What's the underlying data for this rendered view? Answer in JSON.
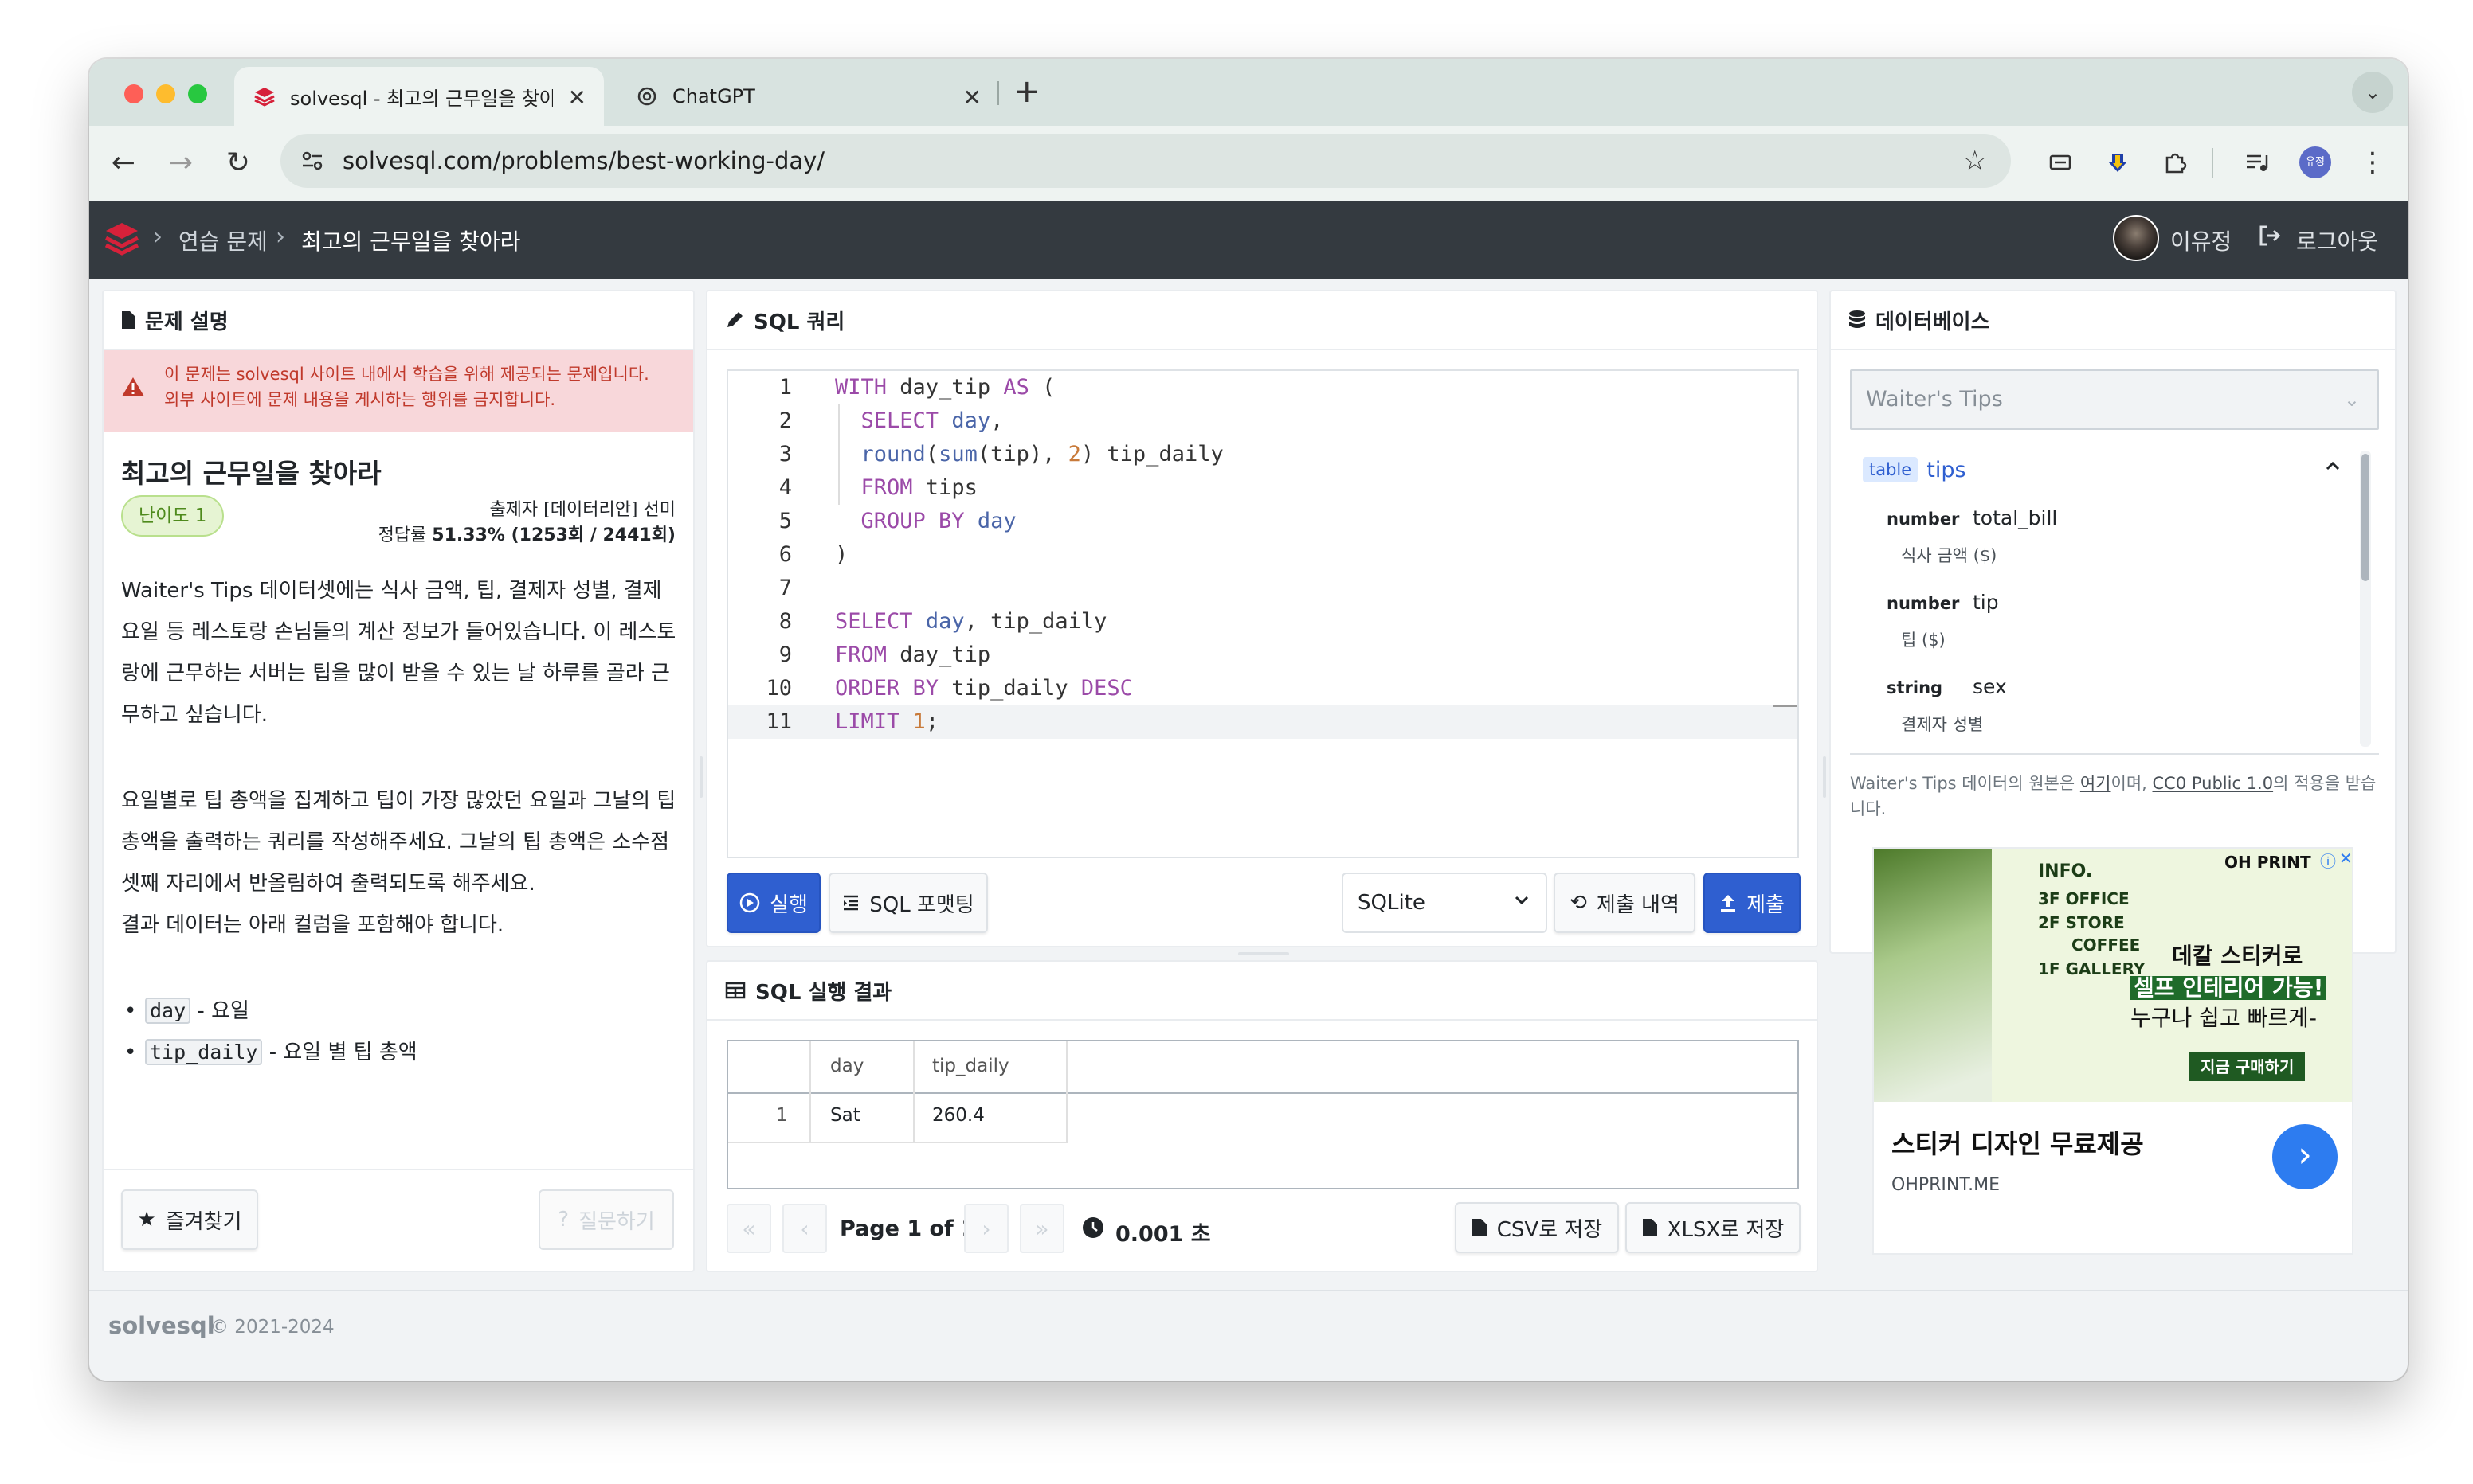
{
  "browser": {
    "tabs": [
      {
        "title": "solvesql - 최고의 근무일을 찾아라",
        "active": true
      },
      {
        "title": "ChatGPT",
        "active": false
      }
    ],
    "url": "solvesql.com/problems/best-working-day/"
  },
  "header": {
    "breadcrumbs": [
      "연습 문제",
      "최고의 근무일을 찾아라"
    ],
    "user_name": "이유정",
    "logout_label": "로그아웃",
    "profile_badge": "유정"
  },
  "problem": {
    "panel_title": "문제 설명",
    "alert_line1": "이 문제는 solvesql 사이트 내에서 학습을 위해 제공되는 문제입니다.",
    "alert_line2": "외부 사이트에 문제 내용을 게시하는 행위를 금지합니다.",
    "title": "최고의 근무일을 찾아라",
    "level": "난이도 1",
    "author": "출제자 [데이터리안] 선미",
    "accuracy_label": "정답률",
    "accuracy_value": "51.33% (1253회 / 2441회)",
    "paragraph1": "Waiter's Tips 데이터셋에는 식사 금액, 팁, 결제자 성별, 결제 요일 등 레스토랑 손님들의 계산 정보가 들어있습니다. 이 레스토랑에 근무하는 서버는 팁을 많이 받을 수 있는 날 하루를 골라 근무하고 싶습니다.",
    "paragraph2": "요일별로 팁 총액을 집계하고 팁이 가장 많았던 요일과 그날의 팁 총액을 출력하는 쿼리를 작성해주세요. 그날의 팁 총액은 소수점 셋째 자리에서 반올림하여 출력되도록 해주세요.",
    "paragraph3": "결과 데이터는 아래 컬럼을 포함해야 합니다.",
    "columns": [
      {
        "name": "day",
        "desc": "- 요일"
      },
      {
        "name": "tip_daily",
        "desc": "- 요일 별 팁 총액"
      }
    ],
    "bookmark_label": "즐겨찾기",
    "ask_label": "질문하기"
  },
  "query": {
    "panel_title": "SQL 쿼리",
    "lines": [
      "WITH day_tip AS (",
      "  SELECT day,",
      "  round(sum(tip), 2) tip_daily",
      "  FROM tips",
      "  GROUP BY day",
      ")",
      "",
      "SELECT day, tip_daily",
      "FROM day_tip",
      "ORDER BY tip_daily DESC",
      "LIMIT 1;"
    ],
    "run_label": "실행",
    "format_label": "SQL 포맷팅",
    "engine": "SQLite",
    "history_label": "제출 내역",
    "submit_label": "제출"
  },
  "result": {
    "panel_title": "SQL 실행 결과",
    "headers": [
      "day",
      "tip_daily"
    ],
    "rows": [
      {
        "index": "1",
        "day": "Sat",
        "tip_daily": "260.4"
      }
    ],
    "page_label": "Page 1 of 1",
    "time": "0.001 초",
    "csv_label": "CSV로 저장",
    "xlsx_label": "XLSX로 저장"
  },
  "database": {
    "panel_title": "데이터베이스",
    "dataset": "Waiter's Tips",
    "table_tag": "table",
    "table_name": "tips",
    "columns": [
      {
        "type": "number",
        "name": "total_bill",
        "desc": "식사 금액 ($)"
      },
      {
        "type": "number",
        "name": "tip",
        "desc": "팁 ($)"
      },
      {
        "type": "string",
        "name": "sex",
        "desc": "결제자 성별"
      }
    ],
    "note_prefix": "Waiter's Tips 데이터의 원본은 ",
    "note_link1": "여기",
    "note_mid": "이며, ",
    "note_link2": "CC0 Public 1.0",
    "note_suffix": "의 적용을 받습니다."
  },
  "ad": {
    "brand_top": "OH PRINT",
    "info": "INFO.",
    "floors": [
      "3F OFFICE",
      "2F STORE",
      "COFFEE",
      "1F GALLERY"
    ],
    "copy1": "데칼 스티커로",
    "copy2": "셀프 인테리어 가능!",
    "copy3": "누구나 쉽고 빠르게-",
    "cta": "지금 구매하기",
    "headline": "스티커 디자인 무료제공",
    "domain": "OHPRINT.ME"
  },
  "footer": {
    "brand": "solvesql",
    "copyright": "© 2021-2024"
  },
  "colors": {
    "primary": "#2f5fd0",
    "brand_red": "#d6213a",
    "header_bg": "#343a40",
    "alert_bg": "#f8d7da"
  }
}
